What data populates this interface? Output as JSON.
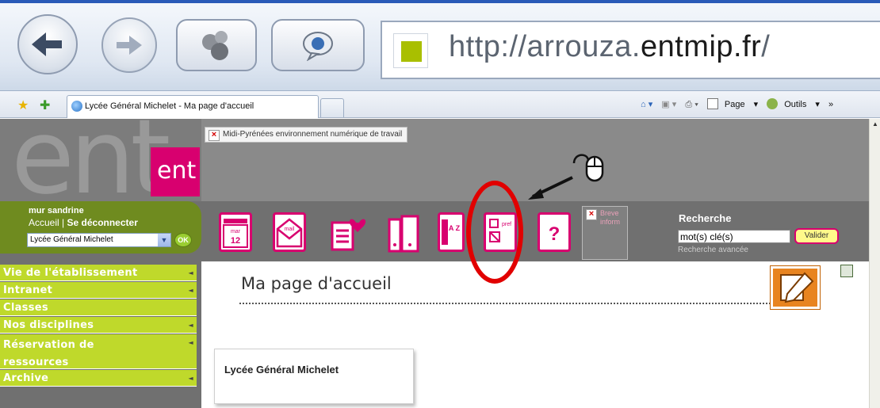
{
  "browser": {
    "url_prefix": "http://arrouza.",
    "url_domain": "entmip.fr",
    "url_suffix": "/",
    "tab_title": "Lycée Général Michelet - Ma page d'accueil",
    "tools": {
      "page_label": "Page",
      "outils_label": "Outils",
      "more": "»"
    }
  },
  "header": {
    "broken_banner": "Midi-Pyrénées environnement numérique de travail",
    "broken_news": "Breve inform",
    "logo_text": "ent",
    "logo_big": "ent"
  },
  "user": {
    "name": "mur sandrine",
    "accueil": "Accueil",
    "separator": "|",
    "logout": "Se déconnecter",
    "school_select": "Lycée Général Michelet",
    "ok": "OK"
  },
  "apps": {
    "calendar_month": "mar",
    "calendar_day": "12",
    "mail": "mail",
    "pref": "pref",
    "az": "A Z",
    "help": "?"
  },
  "search": {
    "title": "Recherche",
    "placeholder": "mot(s) clé(s)",
    "button": "Valider",
    "advanced": "Recherche avancée"
  },
  "sidebar": {
    "items": [
      {
        "label": "Vie de l'établissement",
        "has_arrow": true
      },
      {
        "label": "Intranet",
        "has_arrow": true
      },
      {
        "label": "Classes",
        "has_arrow": false
      },
      {
        "label": "Nos disciplines",
        "has_arrow": true
      },
      {
        "label": "Réservation de ressources",
        "has_arrow": true
      },
      {
        "label": "Archive",
        "has_arrow": true
      }
    ]
  },
  "main": {
    "page_title": "Ma page d'accueil",
    "card_title": "Lycée Général Michelet"
  },
  "colors": {
    "accent_pink": "#d8006f",
    "menu_green": "#bfd92b",
    "annotation_red": "#e10000"
  }
}
